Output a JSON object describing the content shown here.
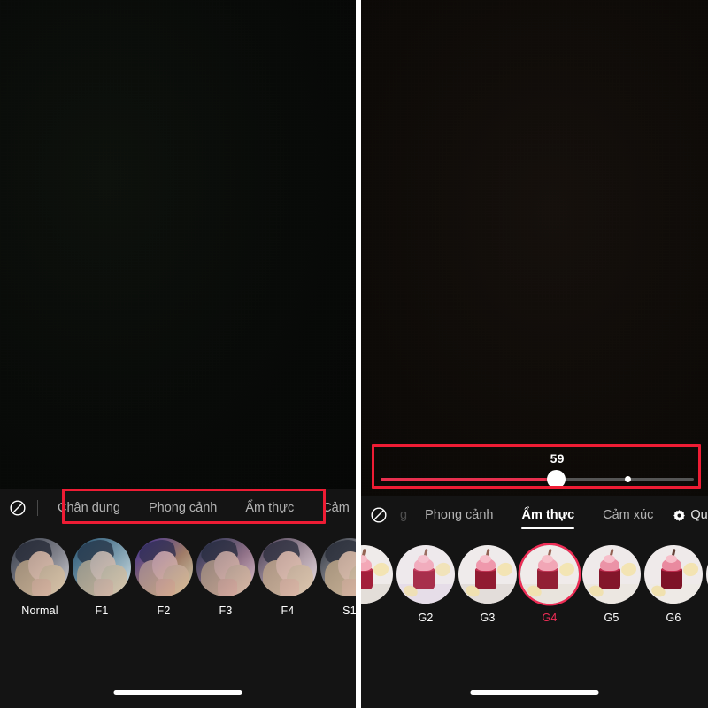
{
  "app": {
    "kind": "camera-filter-ui",
    "accent_red": "#ee1c34",
    "selected_accent": "#ef2d56"
  },
  "left_panel": {
    "no_filter_icon": "ban-icon",
    "tabs": [
      {
        "label": "Chân dung",
        "active": false
      },
      {
        "label": "Phong cảnh",
        "active": false
      },
      {
        "label": "Ẩm thực",
        "active": false
      },
      {
        "label": "Cảm",
        "active": false
      }
    ],
    "filters": [
      {
        "label": "Normal",
        "selected": false
      },
      {
        "label": "F1",
        "selected": false
      },
      {
        "label": "F2",
        "selected": false
      },
      {
        "label": "F3",
        "selected": false
      },
      {
        "label": "F4",
        "selected": false
      },
      {
        "label": "S1",
        "selected": false
      }
    ],
    "annotation": "red-highlight-around-category-tabs"
  },
  "right_panel": {
    "no_filter_icon": "ban-icon",
    "slider": {
      "value": "59",
      "fill_percent": 56,
      "marker_percent": 78
    },
    "tabs": [
      {
        "label": "g",
        "active": false
      },
      {
        "label": "Phong cảnh",
        "active": false
      },
      {
        "label": "Ẩm thực",
        "active": true
      },
      {
        "label": "Cảm xúc",
        "active": false
      }
    ],
    "settings": {
      "icon": "gear-icon",
      "label": "Qu"
    },
    "filters": [
      {
        "label": "",
        "selected": false
      },
      {
        "label": "G2",
        "selected": false
      },
      {
        "label": "G3",
        "selected": false
      },
      {
        "label": "G4",
        "selected": true
      },
      {
        "label": "G5",
        "selected": false
      },
      {
        "label": "G6",
        "selected": false
      },
      {
        "label": "",
        "selected": false
      }
    ],
    "annotation": "red-highlight-around-intensity-slider"
  }
}
